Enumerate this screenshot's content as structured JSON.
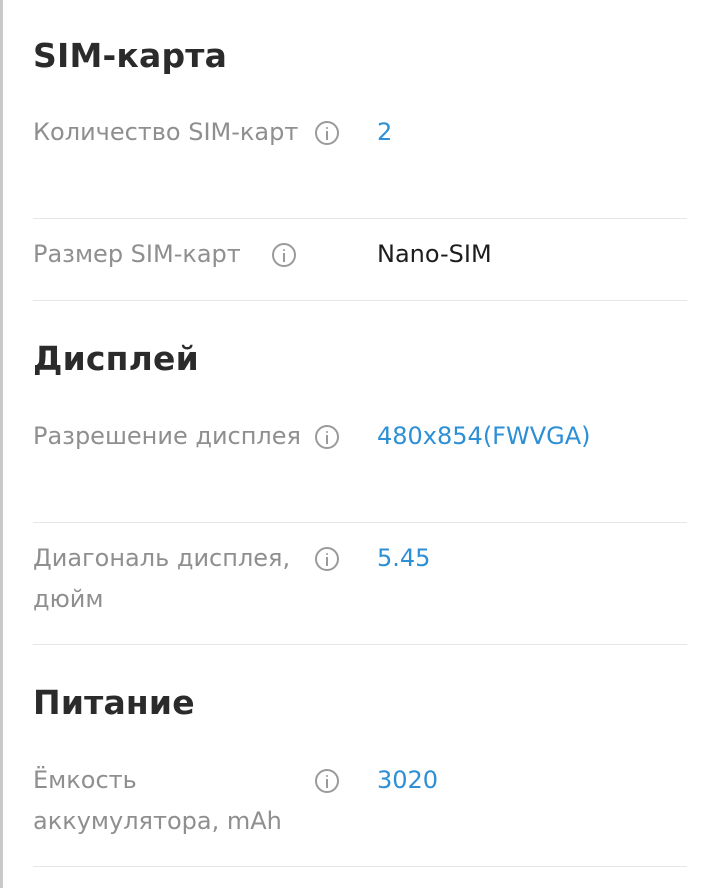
{
  "sections": [
    {
      "title": "SIM-карта",
      "rows": [
        {
          "label": "Количество SIM-карт",
          "value": "2"
        },
        {
          "label": "Размер SIM-карт",
          "value": "Nano-SIM"
        }
      ]
    },
    {
      "title": "Дисплей",
      "rows": [
        {
          "label": "Разрешение дисплея",
          "value": "480x854(FWVGA)"
        },
        {
          "label": "Диагональ дисплея, дюйм",
          "value": "5.45"
        }
      ]
    },
    {
      "title": "Питание",
      "rows": [
        {
          "label": "Ёмкость аккумулятора, mAh",
          "value": "3020"
        }
      ]
    }
  ],
  "colors": {
    "heading": "#2b2b2b",
    "label": "#8f8f8f",
    "link_value": "#2d8fd5",
    "plain_value": "#1d1d1d",
    "divider": "#e6e6e6"
  },
  "icons": {
    "info": "info-circle-icon"
  }
}
